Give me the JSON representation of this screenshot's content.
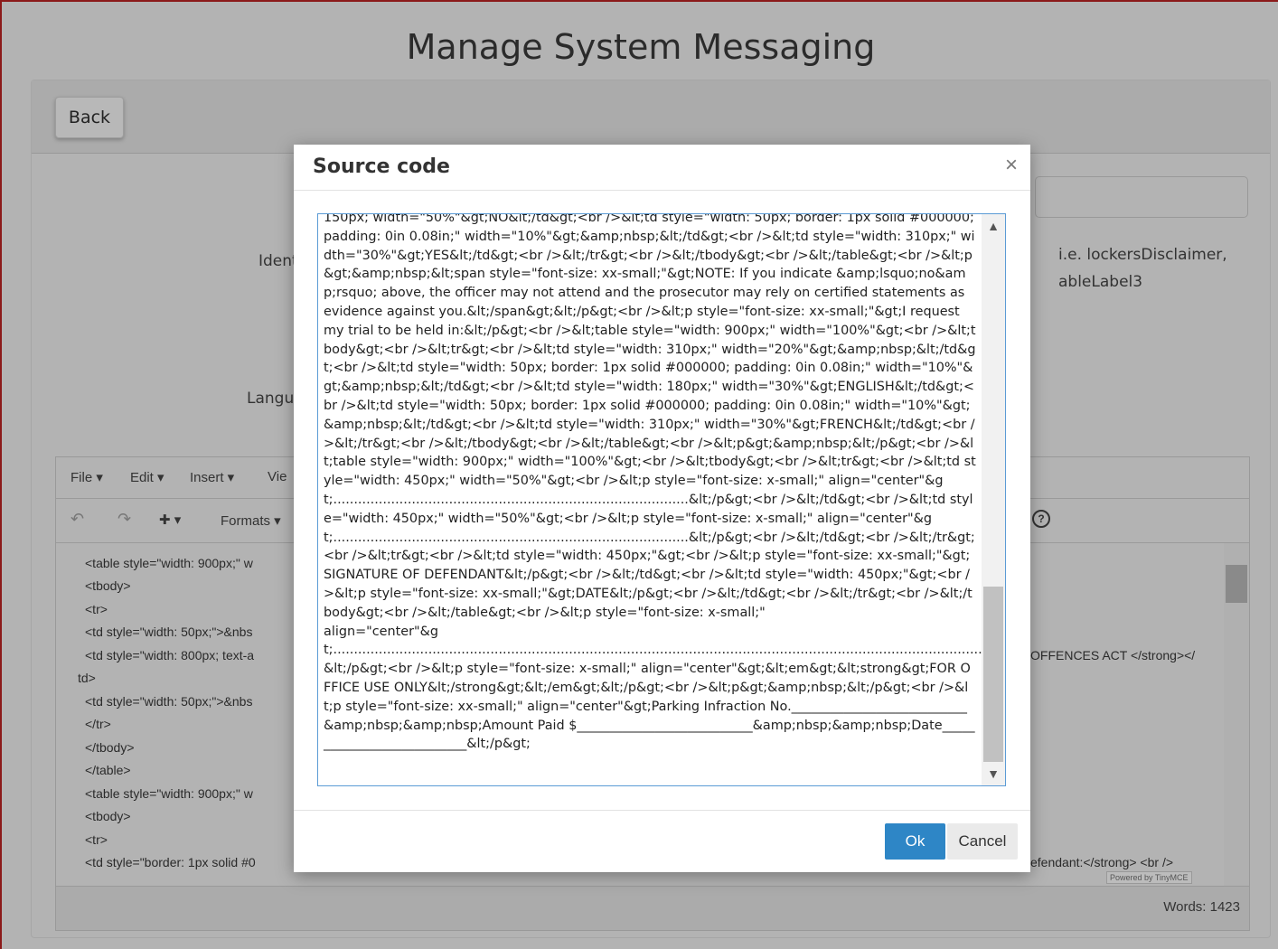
{
  "page": {
    "title": "Manage System Messaging"
  },
  "header": {
    "back_label": "Back"
  },
  "form": {
    "identifier_label": "Ident",
    "language_label": "Langu",
    "help_text": "i.e. lockersDisclaimer, ",
    "help_text_2": "ableLabel3"
  },
  "editor": {
    "menu": {
      "file": "File ▾",
      "edit": "Edit ▾",
      "insert": "Insert ▾",
      "view": "Vie"
    },
    "toolbar": {
      "undo_icon": "↶",
      "redo_icon": "↷",
      "add_icon": "✚ ▾",
      "formats": "Formats ▾",
      "help_icon": "?"
    },
    "code_lines": [
      "<table style=\"width: 900px;\" w",
      "<tbody>",
      "<tr>",
      "<td style=\"width: 50px;\">&nbs",
      "<td style=\"width: 800px; text-a",
      "td>",
      "<td style=\"width: 50px;\">&nbs",
      "</tr>",
      "</tbody>",
      "</table>",
      "<table style=\"width: 900px;\" w",
      "<tbody>",
      "<tr>",
      "<td style=\"border: 1px solid #0"
    ],
    "code_right_1": "OFFENCES ACT </strong></",
    "code_right_2": "efendant:</strong> <br />",
    "powered_by": "Powered by TinyMCE",
    "word_count": "Words: 1423"
  },
  "modal": {
    "title": "Source code",
    "close_icon": "×",
    "source": "150px; width=\"50%\"&gt;NO&lt;/td&gt;<br />&lt;td style=\"width: 50px; border: 1px solid #000000; padding: 0in 0.08in;\" width=\"10%\"&gt;&amp;nbsp;&lt;/td&gt;<br />&lt;td style=\"width: 310px;\" width=\"30%\"&gt;YES&lt;/td&gt;<br />&lt;/tr&gt;<br />&lt;/tbody&gt;<br />&lt;/table&gt;<br />&lt;p&gt;&amp;nbsp;&lt;span style=\"font-size: xx-small;\"&gt;NOTE: If you indicate &amp;lsquo;no&amp;rsquo; above, the officer may not attend and the prosecutor may rely on certified statements as evidence against you.&lt;/span&gt;&lt;/p&gt;<br />&lt;p style=\"font-size: xx-small;\"&gt;I request my trial to be held in:&lt;/p&gt;<br />&lt;table style=\"width: 900px;\" width=\"100%\"&gt;<br />&lt;tbody&gt;<br />&lt;tr&gt;<br />&lt;td style=\"width: 310px;\" width=\"20%\"&gt;&amp;nbsp;&lt;/td&gt;<br />&lt;td style=\"width: 50px; border: 1px solid #000000; padding: 0in 0.08in;\" width=\"10%\"&gt;&amp;nbsp;&lt;/td&gt;<br />&lt;td style=\"width: 180px;\" width=\"30%\"&gt;ENGLISH&lt;/td&gt;<br />&lt;td style=\"width: 50px; border: 1px solid #000000; padding: 0in 0.08in;\" width=\"10%\"&gt;&amp;nbsp;&lt;/td&gt;<br />&lt;td style=\"width: 310px;\" width=\"30%\"&gt;FRENCH&lt;/td&gt;<br />&lt;/tr&gt;<br />&lt;/tbody&gt;<br />&lt;/table&gt;<br />&lt;p&gt;&amp;nbsp;&lt;/p&gt;<br />&lt;table style=\"width: 900px;\" width=\"100%\"&gt;<br />&lt;tbody&gt;<br />&lt;tr&gt;<br />&lt;td style=\"width: 450px;\" width=\"50%\"&gt;<br />&lt;p style=\"font-size: x-small;\" align=\"center\"&gt;......................................................................................&lt;/p&gt;<br />&lt;/td&gt;<br />&lt;td style=\"width: 450px;\" width=\"50%\"&gt;<br />&lt;p style=\"font-size: x-small;\" align=\"center\"&gt;......................................................................................&lt;/p&gt;<br />&lt;/td&gt;<br />&lt;/tr&gt;<br />&lt;tr&gt;<br />&lt;td style=\"width: 450px;\"&gt;<br />&lt;p style=\"font-size: xx-small;\"&gt;SIGNATURE OF DEFENDANT&lt;/p&gt;<br />&lt;/td&gt;<br />&lt;td style=\"width: 450px;\"&gt;<br />&lt;p style=\"font-size: xx-small;\"&gt;DATE&lt;/p&gt;<br />&lt;/td&gt;<br />&lt;/tr&gt;<br />&lt;/tbody&gt;<br />&lt;/table&gt;<br />&lt;p style=\"font-size: x-small;\"\nalign=\"center\"&gt;.........................................................................................................................................................................................&lt;/p&gt;<br />&lt;p style=\"font-size: x-small;\" align=\"center\"&gt;&lt;em&gt;&lt;strong&gt;FOR OFFICE USE ONLY&lt;/strong&gt;&lt;/em&gt;&lt;/p&gt;<br />&lt;p&gt;&amp;nbsp;&lt;/p&gt;<br />&lt;p style=\"font-size: xx-small;\" align=\"center\"&gt;Parking Infraction No.___________________________&amp;nbsp;&amp;nbsp;Amount Paid $___________________________&amp;nbsp;&amp;nbsp;Date___________________________&lt;/p&gt;",
    "ok_label": "Ok",
    "cancel_label": "Cancel"
  }
}
